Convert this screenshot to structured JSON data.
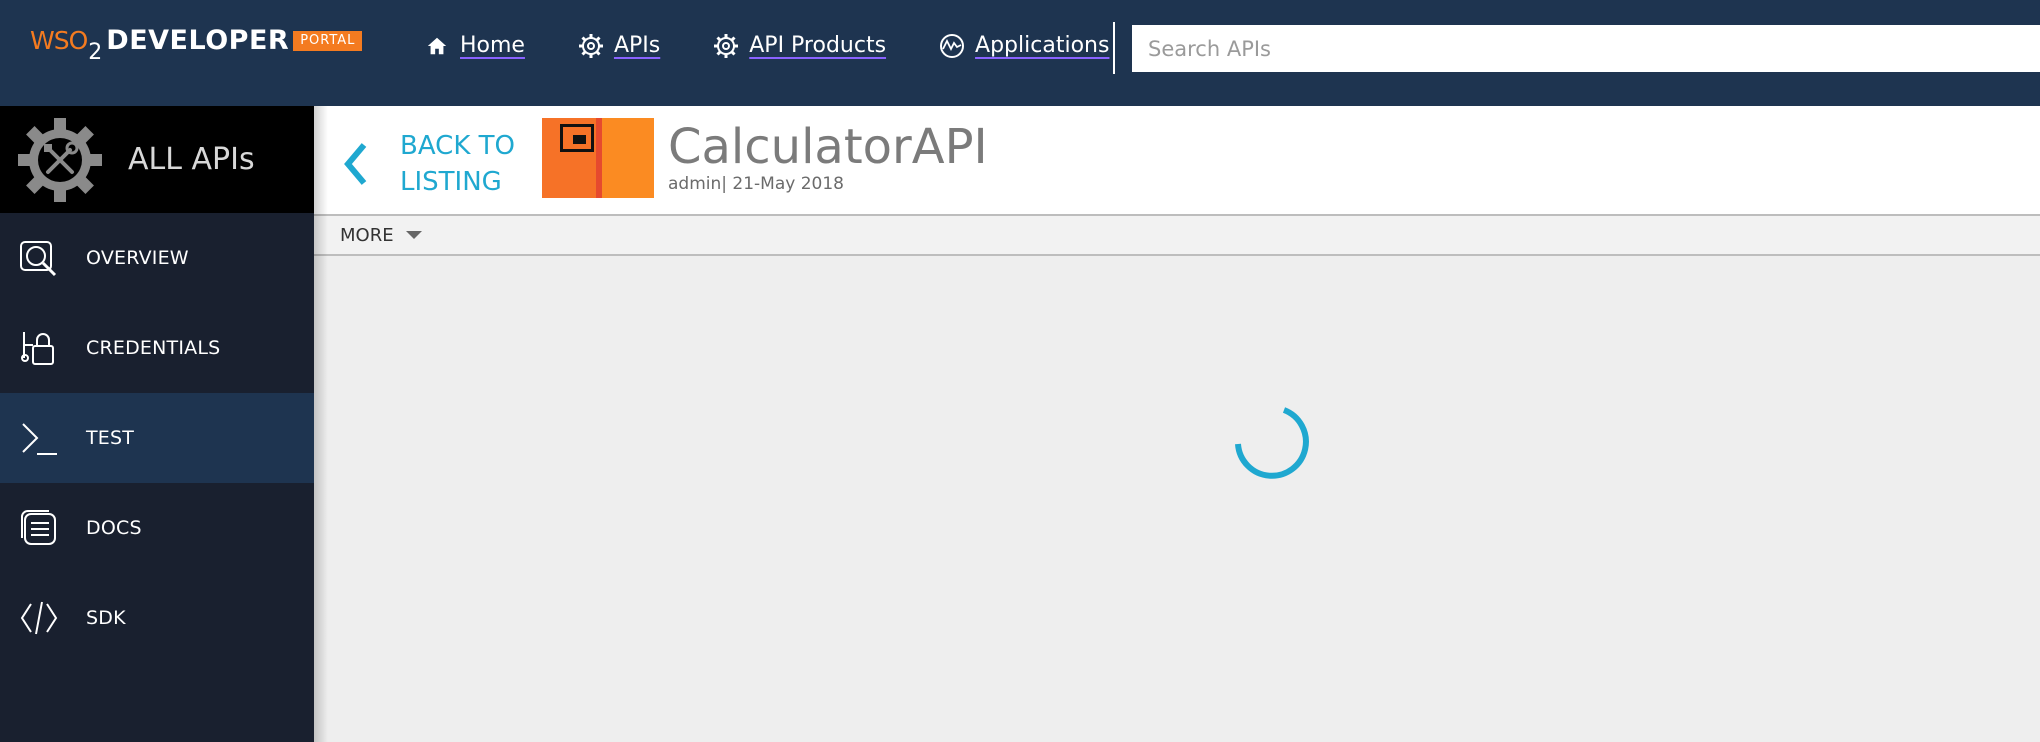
{
  "topbar": {
    "logo": {
      "wso": "WSO",
      "two": "2",
      "developer": "DEVELOPER",
      "portal": "PORTAL"
    },
    "nav": [
      {
        "label": "Home",
        "icon": "home-icon"
      },
      {
        "label": "APIs",
        "icon": "gear-icon"
      },
      {
        "label": "API Products",
        "icon": "gear-icon"
      },
      {
        "label": "Applications",
        "icon": "applications-icon"
      }
    ],
    "search": {
      "placeholder": "Search APIs",
      "value": ""
    },
    "colors": {
      "background": "#1e3450",
      "accent": "#f47b20"
    }
  },
  "sidebar": {
    "header": {
      "label": "ALL APIs",
      "icon": "gear-tools-icon"
    },
    "items": [
      {
        "label": "OVERVIEW",
        "icon": "overview-icon",
        "active": false
      },
      {
        "label": "CREDENTIALS",
        "icon": "credentials-icon",
        "active": false
      },
      {
        "label": "TEST",
        "icon": "terminal-icon",
        "active": true
      },
      {
        "label": "DOCS",
        "icon": "docs-icon",
        "active": false
      },
      {
        "label": "SDK",
        "icon": "code-icon",
        "active": false
      }
    ]
  },
  "api": {
    "back_label": "BACK TO LISTING",
    "name": "CalculatorAPI",
    "meta": "admin| 21-May 2018",
    "more_label": "MORE"
  },
  "content": {
    "loading": true,
    "spinner_color": "#1fa8d0"
  }
}
